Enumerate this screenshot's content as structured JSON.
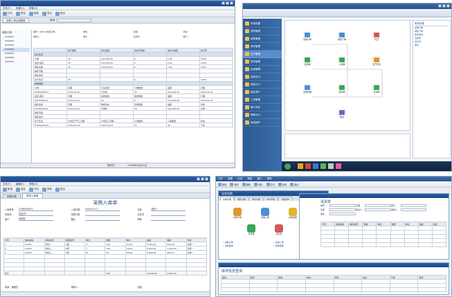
{
  "panel1": {
    "title": "",
    "menu": [
      "文件(F)",
      "查看(V)",
      "帮助(H)"
    ],
    "toolbar": [
      "打印",
      "预览",
      "刷新",
      "导出",
      "退出"
    ],
    "tab": "销售订单全程跟踪",
    "search_label": "查询",
    "tree": [
      "销售订单",
      "0000001",
      "0000002",
      "0000003",
      "0000004",
      "0000005",
      "0000006",
      "0000007"
    ],
    "header_fields": [
      "编号：0000 (新建订单)",
      "单位：",
      "日期：",
      "状态：",
      "审核人：",
      "客户：",
      "业务员：",
      "部门："
    ],
    "grid_cols": [
      "",
      "执行数量",
      "执行金额",
      "未执行数量",
      "未执行金额",
      "执行率"
    ],
    "grid_rows": [
      {
        "sec": true,
        "cells": [
          "执行情况",
          "",
          "",
          "",
          "",
          ""
        ]
      },
      {
        "sec": false,
        "cells": [
          "订单",
          "30",
          "102,000.00",
          "0",
          "0.00",
          "100%"
        ]
      },
      {
        "sec": false,
        "cells": [
          "发货/退货",
          "30",
          "102,000.00",
          "0",
          "0.00",
          "100%"
        ]
      },
      {
        "sec": false,
        "cells": [
          "销售出库",
          "30",
          "102,000.00",
          "0",
          "0.00",
          "100%"
        ]
      },
      {
        "sec": false,
        "cells": [
          "销售开票",
          "",
          "",
          "",
          "",
          ""
        ]
      },
      {
        "sec": false,
        "cells": [
          "销售收款",
          "",
          "",
          "",
          "",
          ""
        ]
      },
      {
        "sec": false,
        "cells": [
          "生产任务",
          "30",
          "",
          "0",
          "",
          "100%"
        ]
      },
      {
        "sec": true,
        "cells": [
          "单据明细",
          "",
          "",
          "",
          "",
          ""
        ]
      },
      {
        "sec": false,
        "cells": [
          "订单",
          "日期",
          "行业名称",
          "订单数量",
          "金额",
          "日期"
        ]
      },
      {
        "sec": false,
        "cells": [
          "XSDD000001",
          "2000-02-01",
          "已关闭",
          "30",
          "102,000.00",
          "2000-02-01"
        ]
      },
      {
        "sec": false,
        "cells": [
          "发货/退货",
          "日期",
          "发货数量",
          "退货数量",
          "金额",
          "日期"
        ]
      },
      {
        "sec": false,
        "cells": [
          "XSFH000001",
          "2000-02-01",
          "30",
          "0",
          "102,000.00",
          "2000-02-01"
        ]
      },
      {
        "sec": false,
        "cells": [
          "销售出库",
          "日期",
          "审核状态",
          "出库数量",
          "金额",
          "仓库"
        ]
      },
      {
        "sec": false,
        "cells": [
          "XSCK000001",
          "2000-02-01",
          "已审核",
          "30",
          "102,000.00",
          "仓库一"
        ]
      },
      {
        "sec": false,
        "cells": [
          "销售开票",
          "",
          "",
          "",
          "",
          ""
        ]
      },
      {
        "sec": false,
        "cells": [
          "销售收款",
          "",
          "",
          "",
          "",
          ""
        ]
      },
      {
        "sec": false,
        "cells": [
          "生产任务",
          "计划生产开工日期",
          "计划完工日期",
          "计划数量",
          "入库数量",
          "状态"
        ]
      },
      {
        "sec": false,
        "cells": [
          "SCRW000001",
          "2000-02-01",
          "2000-02-05",
          "30",
          "30",
          "下达"
        ]
      }
    ],
    "status": [
      "",
      "操作员：",
      "",
      "2000年02月01日"
    ]
  },
  "panel2": {
    "title": "",
    "sidebar": [
      "系统设置",
      "采购管理",
      "销售管理",
      "库存管理",
      "生产管理",
      "财务管理",
      "出纳管理",
      "应收应付",
      "报表中心",
      "固定资产",
      "工资管理",
      "客户关系",
      "帮助中心",
      "系统维护"
    ],
    "nodes": [
      "采购订单",
      "销售订单",
      "出库单",
      "入库单",
      "生产任务",
      "出纳管理",
      "收款单",
      "付款单",
      "凭证",
      "报表"
    ],
    "right_box_title": "常用功能",
    "right_box_items": [
      "采购订单",
      "销售订单",
      "库存查询",
      "应收款",
      "应付款",
      "报表"
    ]
  },
  "panel3": {
    "title": "",
    "menu": [
      "文件(F)",
      "编辑(E)",
      "帮助(H)"
    ],
    "toolbar": [
      "新增",
      "保存",
      "打印",
      "审核",
      "退出"
    ],
    "tabs": [
      "单据列表",
      "采购入库单"
    ],
    "doc_title": "采购入库单",
    "fields_row1": [
      [
        "入库单号",
        "CGRK000001"
      ],
      [
        "入库日期",
        "2000-02-01"
      ],
      [
        "仓库",
        "仓库一"
      ]
    ],
    "fields_row2": [
      [
        "供应商",
        "供应商一"
      ],
      [
        "采购订单",
        ""
      ],
      [
        "业务员",
        ""
      ]
    ],
    "fields_row3": [
      [
        "部门",
        "采购部"
      ],
      [
        "备注",
        ""
      ],
      [
        "审核",
        ""
      ]
    ],
    "grid_cols": [
      "行号",
      "物料编码",
      "物料名称",
      "规格型号",
      "单位",
      "数量",
      "单价",
      "金额",
      "税额",
      "仓库"
    ],
    "grid_rows": [
      [
        "1",
        "01001",
        "材料一",
        "A型",
        "个",
        "100",
        "50.00",
        "5,000.00",
        "850.00",
        "仓库一"
      ],
      [
        "2",
        "01002",
        "材料二",
        "B型",
        "个",
        "200",
        "30.00",
        "6,000.00",
        "1,020.00",
        "仓库一"
      ],
      [
        "3",
        "01003",
        "材料三",
        "C型",
        "件",
        "50",
        "80.00",
        "4,000.00",
        "680.00",
        "仓库一"
      ]
    ],
    "total_label": "合计",
    "total_values": [
      "350",
      "15,000.00",
      "2,550.00"
    ],
    "footer_fields": [
      [
        "制单",
        "管理员"
      ],
      [
        "审核人",
        ""
      ],
      [
        "记账",
        ""
      ]
    ]
  },
  "panel4": {
    "menu": [
      "文件",
      "视图",
      "业务",
      "报表",
      "窗口",
      "帮助"
    ],
    "toolbar": [
      "新增",
      "修改",
      "删除",
      "保存",
      "打印",
      "查询",
      "退出"
    ],
    "desk_title": "业务导航",
    "desk_tabs": [
      "采购管理",
      "销售管理",
      "库存管理",
      "财务管理",
      "基础资料"
    ],
    "desk_icons": [
      "采购订单",
      "采购入库",
      "采购发票",
      "付款单",
      "应付款"
    ],
    "desk_links": [
      "采购订单",
      "采购入库",
      "采购退货",
      "采购发票"
    ],
    "form_title": "请货单",
    "form_fields": [
      "单号",
      "日期",
      "部门",
      "仓库",
      "申请人",
      "审核人",
      "备注"
    ],
    "form_grid_cols": [
      "行号",
      "物料编码",
      "物料名称",
      "规格",
      "单位",
      "数量",
      "单价",
      "金额",
      "备注"
    ],
    "bottom_title": "库存信息查询",
    "bottom_cols": [
      "编码",
      "名称",
      "规格",
      "单位",
      "库存",
      "在途",
      "可用",
      "仓库"
    ]
  }
}
